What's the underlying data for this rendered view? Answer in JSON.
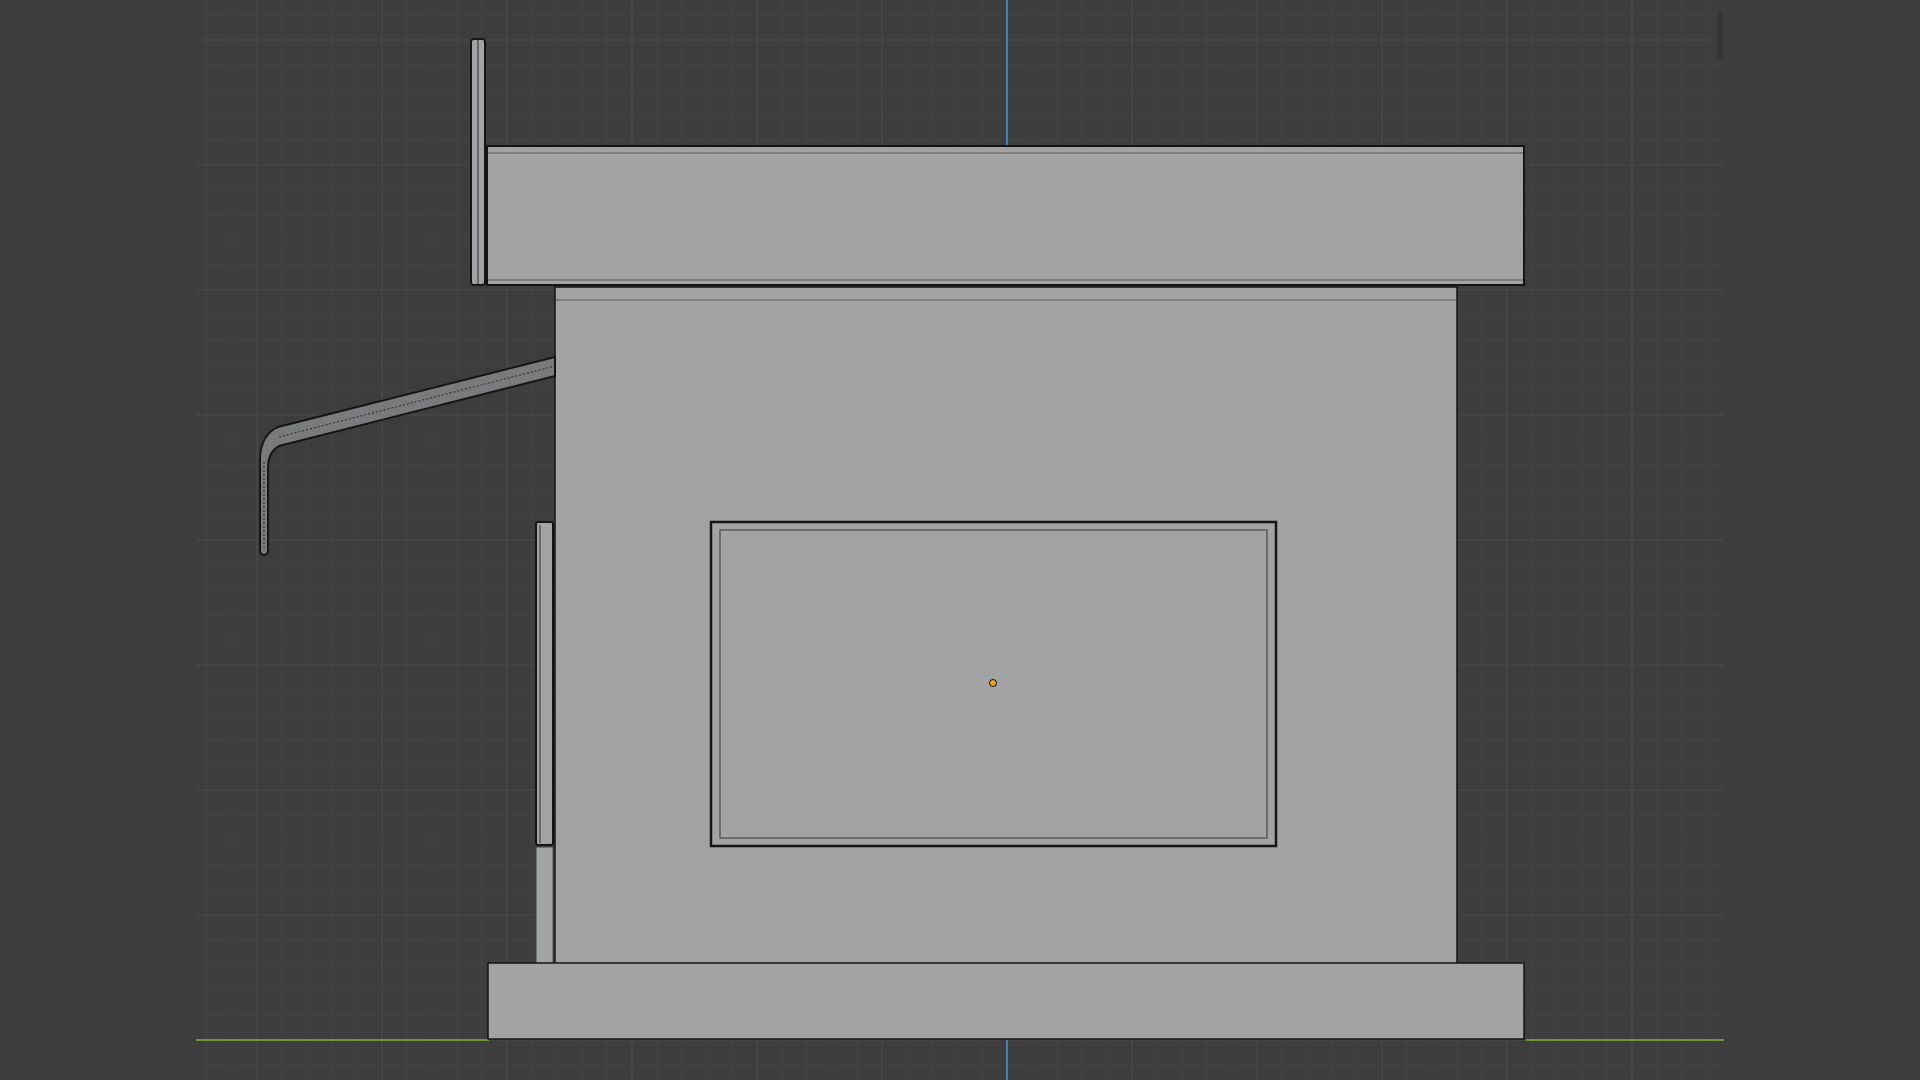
{
  "viewport": {
    "mode": "3d-viewport",
    "view": "side-orthographic",
    "shading": "solid",
    "grid": true,
    "colors": {
      "background": "#3d3d3d",
      "grid_minor": "#454545",
      "grid_major": "#4a4a4a",
      "axis_z": "#4a7fb5",
      "axis_y": "#6f9a3a",
      "mesh_fill": "#a2a3a5",
      "mesh_edge": "#151515",
      "object_origin": "#f0a020"
    },
    "icons": {
      "origin": "object-origin-dot"
    }
  }
}
